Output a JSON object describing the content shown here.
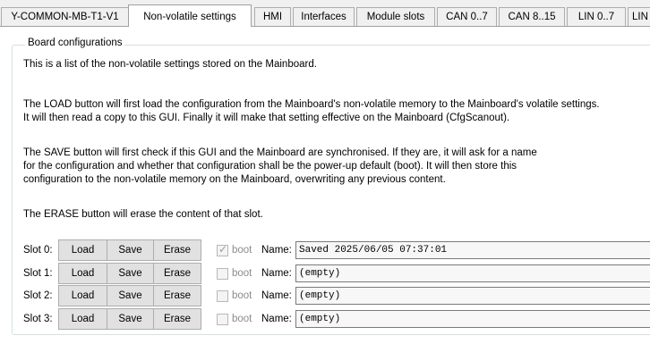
{
  "tabs": [
    {
      "label": "Y-COMMON-MB-T1-V1",
      "active": false
    },
    {
      "label": "Non-volatile settings",
      "active": true
    },
    {
      "label": "HMI",
      "active": false
    },
    {
      "label": "Interfaces",
      "active": false
    },
    {
      "label": "Module slots",
      "active": false
    },
    {
      "label": "CAN 0..7",
      "active": false
    },
    {
      "label": "CAN 8..15",
      "active": false
    },
    {
      "label": "LIN 0..7",
      "active": false
    },
    {
      "label": "LIN",
      "active": false
    }
  ],
  "group": {
    "title": "Board configurations",
    "paragraphs": [
      "This is a list of the non-volatile settings stored on the Mainboard.",
      "The LOAD button will first load the configuration from the Mainboard's non-volatile memory to the Mainboard's volatile settings.",
      "It will then read a copy to this GUI. Finally it will make that setting effective on the Mainboard (CfgScanout).",
      "The SAVE button will first check if this GUI and the Mainboard are synchronised. If they are, it will ask for a name",
      "for the configuration and whether that configuration shall be the power-up default (boot). It will then store this",
      "configuration to the non-volatile memory on the Mainboard, overwriting any previous content.",
      "The ERASE button will erase the content of that slot."
    ]
  },
  "slots": [
    {
      "label": "Slot 0:",
      "boot_checked": true,
      "name": "Saved 2025/06/05 07:37:01"
    },
    {
      "label": "Slot 1:",
      "boot_checked": false,
      "name": "(empty)"
    },
    {
      "label": "Slot 2:",
      "boot_checked": false,
      "name": "(empty)"
    },
    {
      "label": "Slot 3:",
      "boot_checked": false,
      "name": "(empty)"
    }
  ],
  "slot_controls": {
    "load_label": "Load",
    "save_label": "Save",
    "erase_label": "Erase",
    "boot_label": "boot",
    "name_label": "Name:"
  },
  "colors": {
    "window_bg": "#f0f0f0",
    "panel_bg": "#ffffff",
    "button_bg": "#e1e1e1",
    "disabled_text": "#8c8c8c"
  }
}
